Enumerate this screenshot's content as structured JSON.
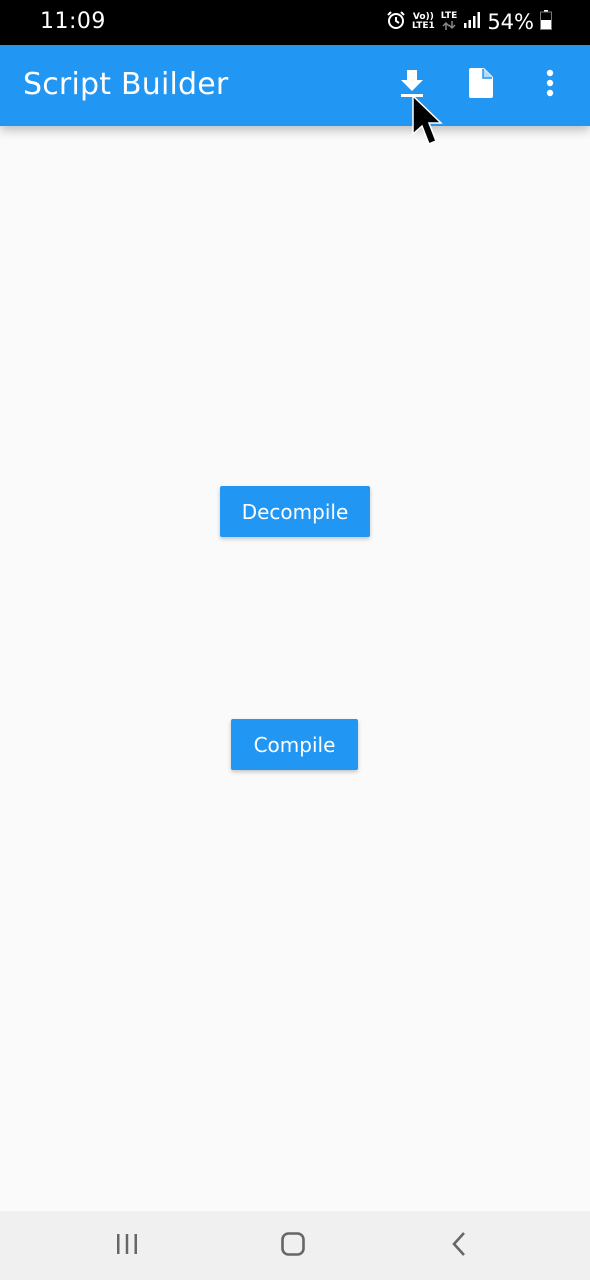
{
  "status_bar": {
    "time": "11:09",
    "net_volte_top": "Vo))",
    "net_volte_bottom": "LTE1",
    "net_lte": "LTE",
    "battery_percent": "54%"
  },
  "app_bar": {
    "title": "Script Builder",
    "actions": [
      {
        "icon": "download-icon"
      },
      {
        "icon": "file-icon"
      },
      {
        "icon": "more-vert-icon"
      }
    ]
  },
  "main": {
    "decompile_label": "Decompile",
    "compile_label": "Compile"
  },
  "nav_bar": {
    "icons": [
      "recents-icon",
      "home-icon",
      "back-icon"
    ]
  },
  "colors": {
    "primary": "#2196f3",
    "background": "#fafafa",
    "status_bar": "#000000",
    "nav_bar": "#f0f0f0"
  }
}
